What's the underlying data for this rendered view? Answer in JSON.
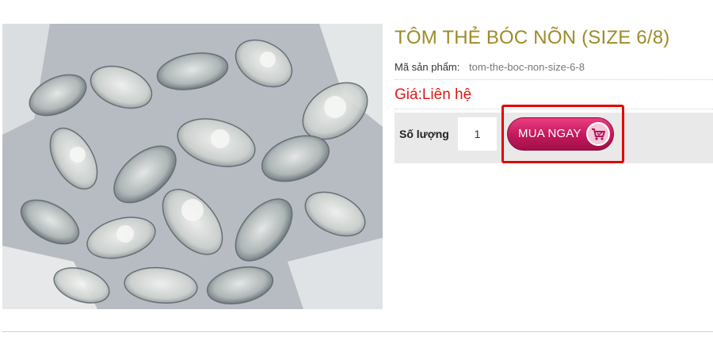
{
  "product": {
    "image_alt": "Tôm thẻ bóc nõn",
    "title": "TÔM THẺ BÓC NÕN (SIZE 6/8)",
    "code_label": "Mã sản phẩm:",
    "code_value": "tom-the-boc-non-size-6-8",
    "price_text": "Giá:Liên hệ",
    "quantity_label": "Số lượng",
    "quantity_value": "1",
    "buy_button_label": "MUA NGAY",
    "buy_button_icon": "cart-icon"
  },
  "colors": {
    "title": "#a08a2a",
    "price": "#e01818",
    "buy_button": "#c2185b",
    "highlight": "#e60000"
  }
}
